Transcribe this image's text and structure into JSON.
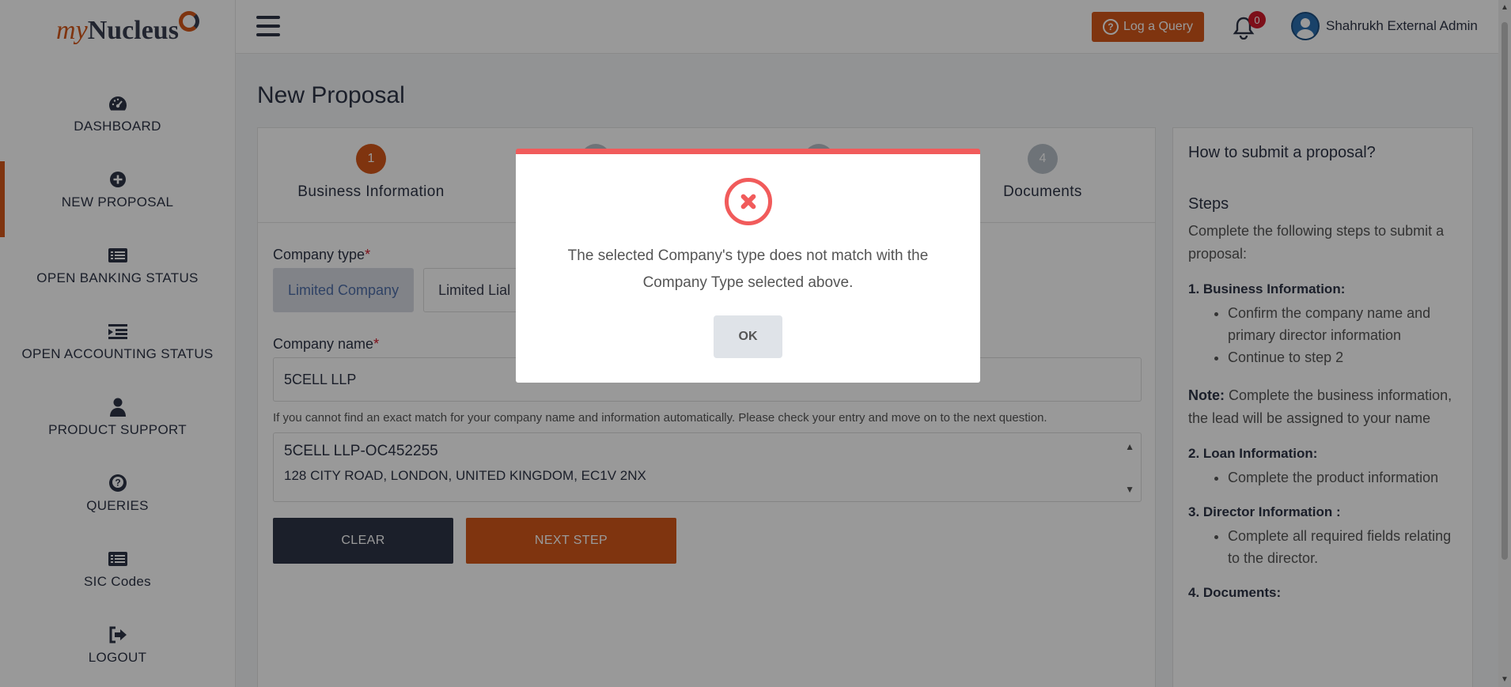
{
  "brand": {
    "my": "my",
    "nucleus": "Nucleus"
  },
  "sidebar": {
    "items": [
      {
        "label": "DASHBOARD",
        "icon": "dashboard-icon"
      },
      {
        "label": "NEW PROPOSAL",
        "icon": "plus-circle-icon"
      },
      {
        "label": "OPEN BANKING STATUS",
        "icon": "list-card-icon"
      },
      {
        "label": "OPEN ACCOUNTING STATUS",
        "icon": "indent-list-icon"
      },
      {
        "label": "PRODUCT SUPPORT",
        "icon": "user-icon"
      },
      {
        "label": "QUERIES",
        "icon": "question-icon"
      },
      {
        "label": "SIC Codes",
        "icon": "list-card-icon"
      },
      {
        "label": "LOGOUT",
        "icon": "logout-icon"
      }
    ]
  },
  "topbar": {
    "query_label": "Log a Query",
    "notif_count": "0",
    "user_name": "Shahrukh External Admin"
  },
  "page": {
    "title": "New Proposal"
  },
  "steps": [
    {
      "num": "1",
      "label": "Business Information"
    },
    {
      "num": "2",
      "label": ""
    },
    {
      "num": "3",
      "label": ""
    },
    {
      "num": "4",
      "label": "Documents"
    }
  ],
  "form": {
    "company_type_label": "Company type",
    "required_mark": "*",
    "type_options": [
      "Limited Company",
      "Limited Lial"
    ],
    "company_name_label": "Company name",
    "company_name_value": "5CELL LLP",
    "hint": "If you cannot find an exact match for your company name and information automatically. Please check your entry and move on to the next question.",
    "result_line1": "5CELL LLP-OC452255",
    "result_line2": "128 CITY ROAD, LONDON, UNITED KINGDOM, EC1V 2NX",
    "clear_label": "CLEAR",
    "next_label": "NEXT STEP"
  },
  "help": {
    "title": "How to submit a proposal?",
    "steps_heading": "Steps",
    "intro": "Complete the following steps to submit a proposal:",
    "sections": [
      {
        "heading": "1. Business Information:",
        "items": [
          "Confirm the company name and primary director information",
          "Continue to step 2"
        ]
      },
      {
        "heading": "2. Loan Information:",
        "items": [
          "Complete the product information"
        ]
      },
      {
        "heading": "3. Director Information :",
        "items": [
          "Complete all required fields relating to the director."
        ]
      },
      {
        "heading": "4. Documents:",
        "items": []
      }
    ],
    "note_label": "Note:",
    "note_text": " Complete the business information, the lead will be assigned to your name"
  },
  "modal": {
    "message": "The selected Company's type does not match with the Company Type selected above.",
    "ok_label": "OK",
    "accent_color": "#f15b5b"
  },
  "colors": {
    "brand_orange": "#d4581a",
    "dark": "#2d3446"
  }
}
